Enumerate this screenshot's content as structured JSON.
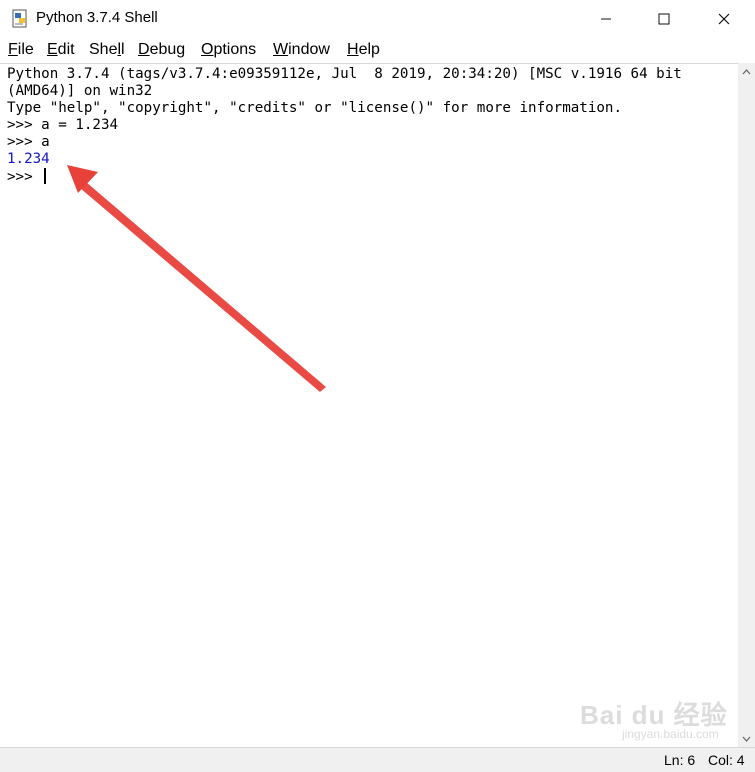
{
  "window": {
    "title": "Python 3.7.4 Shell",
    "controls": {
      "minimize": "minimize",
      "maximize": "maximize",
      "close": "close"
    }
  },
  "menu": [
    {
      "pre": "",
      "ul": "F",
      "post": "ile"
    },
    {
      "pre": "",
      "ul": "E",
      "post": "dit"
    },
    {
      "pre": "She",
      "ul": "l",
      "post": "l"
    },
    {
      "pre": "",
      "ul": "D",
      "post": "ebug"
    },
    {
      "pre": "",
      "ul": "O",
      "post": "ptions"
    },
    {
      "pre": "",
      "ul": "W",
      "post": "indow"
    },
    {
      "pre": "",
      "ul": "H",
      "post": "elp"
    }
  ],
  "shell": {
    "banner1": "Python 3.7.4 (tags/v3.7.4:e09359112e, Jul  8 2019, 20:34:20) [MSC v.1916 64 bit",
    "banner2": "(AMD64)] on win32",
    "banner3": "Type \"help\", \"copyright\", \"credits\" or \"license()\" for more information.",
    "line4": ">>> a = 1.234",
    "line5": ">>> a",
    "output": "1.234",
    "prompt": ">>> "
  },
  "status": {
    "ln": "Ln: 6",
    "col": "Col: 4"
  },
  "watermark": {
    "brand": "Bai du 经验",
    "url": "jingyan.baidu.com"
  },
  "colors": {
    "output": "#1414c8",
    "arrow": "#e8413a"
  }
}
